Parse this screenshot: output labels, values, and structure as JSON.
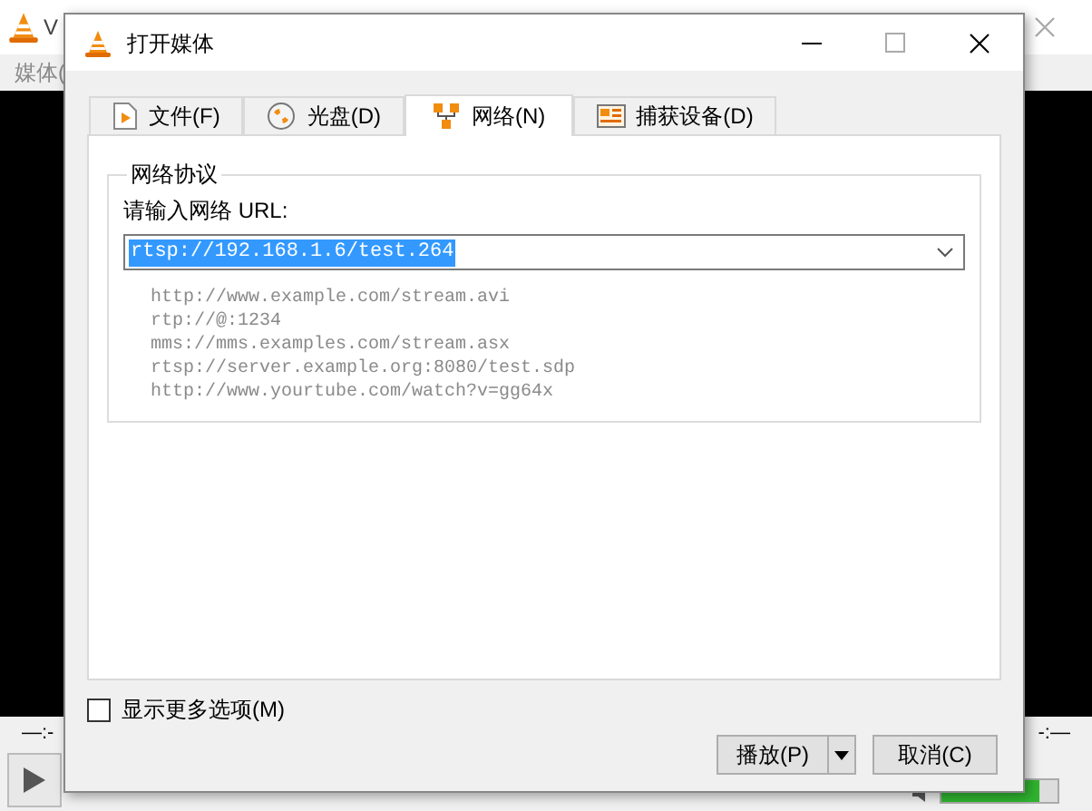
{
  "background_window": {
    "title": "V",
    "menu": [
      "媒体("
    ],
    "time_elapsed": "—:-",
    "time_total": "-:—",
    "volume": {
      "level": 0.85
    }
  },
  "dialog": {
    "title": "打开媒体",
    "tabs": [
      {
        "label": "文件(F)",
        "kind": "file",
        "selected": false
      },
      {
        "label": "光盘(D)",
        "kind": "disc",
        "selected": false
      },
      {
        "label": "网络(N)",
        "kind": "network",
        "selected": true
      },
      {
        "label": "捕获设备(D)",
        "kind": "capture",
        "selected": false
      }
    ],
    "group_title": "网络协议",
    "url_label": "请输入网络 URL:",
    "url_value": "rtsp://192.168.1.6/test.264",
    "examples": [
      "http://www.example.com/stream.avi",
      "rtp://@:1234",
      "mms://mms.examples.com/stream.asx",
      "rtsp://server.example.org:8080/test.sdp",
      "http://www.yourtube.com/watch?v=gg64x"
    ],
    "more_options": {
      "label": "显示更多选项(M)",
      "checked": false
    },
    "buttons": [
      {
        "label": "播放(P)",
        "kind": "split"
      },
      {
        "label": "取消(C)",
        "kind": "plain"
      }
    ]
  }
}
